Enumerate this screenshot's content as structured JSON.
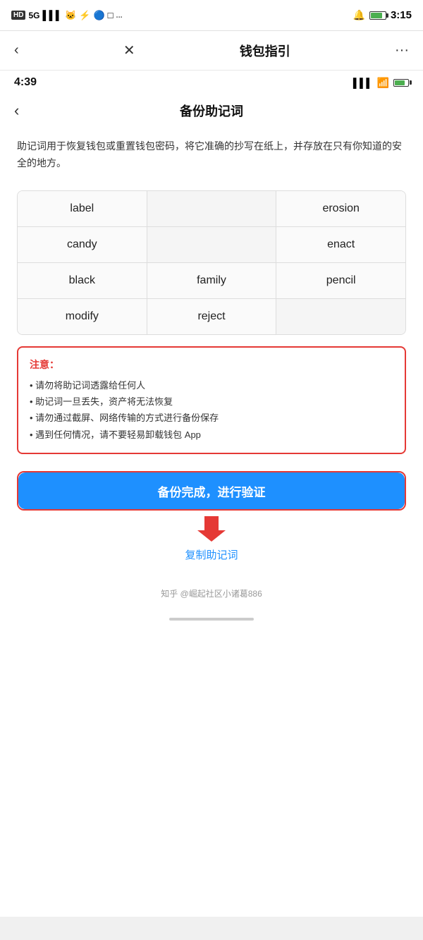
{
  "outerStatusBar": {
    "left": {
      "hd": "HD",
      "signal": "5G",
      "apps": "微博 快手 Q □ ..."
    },
    "right": {
      "time": "3:15"
    }
  },
  "topNav": {
    "backLabel": "‹",
    "closeLabel": "✕",
    "title": "钱包指引",
    "moreLabel": "···"
  },
  "innerStatusBar": {
    "time": "4:39"
  },
  "innerNav": {
    "backLabel": "‹",
    "title": "备份助记词"
  },
  "descText": "助记词用于恢复钱包或重置钱包密码，将它准确的抄写在纸上，并存放在只有你知道的安全的地方。",
  "mnemonicWords": [
    [
      "label",
      "",
      "erosion"
    ],
    [
      "candy",
      "",
      "enact"
    ],
    [
      "black",
      "family",
      "pencil"
    ],
    [
      "modify",
      "reject",
      ""
    ]
  ],
  "warningBox": {
    "title": "注意：",
    "items": [
      "• 请勿将助记词透露给任何人",
      "• 助记词一旦丢失，资产将无法恢复",
      "• 请勿通过截屏、网络传输的方式进行备份保存",
      "• 遇到任何情况，请不要轻易卸载钱包 App"
    ]
  },
  "buttons": {
    "verifyLabel": "备份完成，进行验证",
    "copyLabel": "复制助记词"
  },
  "footer": {
    "text": "知乎 @崛起社区小诸葛886"
  }
}
